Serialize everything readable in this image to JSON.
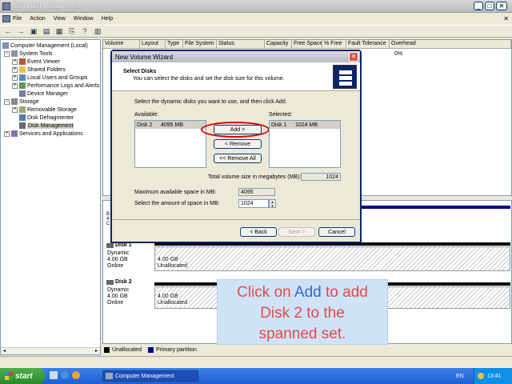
{
  "window": {
    "title": "Computer Management"
  },
  "menu": [
    "File",
    "Action",
    "View",
    "Window",
    "Help"
  ],
  "tree": [
    {
      "label": "Computer Management (Local)",
      "level": 0
    },
    {
      "label": "System Tools",
      "level": 1
    },
    {
      "label": "Event Viewer",
      "level": 2
    },
    {
      "label": "Shared Folders",
      "level": 2
    },
    {
      "label": "Local Users and Groups",
      "level": 2
    },
    {
      "label": "Performance Logs and Alerts",
      "level": 2
    },
    {
      "label": "Device Manager",
      "level": 2
    },
    {
      "label": "Storage",
      "level": 1
    },
    {
      "label": "Removable Storage",
      "level": 2
    },
    {
      "label": "Disk Defragmenter",
      "level": 2
    },
    {
      "label": "Disk Management",
      "level": 2
    },
    {
      "label": "Services and Applications",
      "level": 1
    }
  ],
  "columns": [
    "Volume",
    "Layout",
    "Type",
    "File System",
    "Status",
    "Capacity",
    "Free Space",
    "% Free",
    "Fault Tolerance",
    "Overhead"
  ],
  "overhead_value": "0%",
  "disks": [
    {
      "name": "Disk 1",
      "type": "Dynamic",
      "size": "4.00 GB",
      "status": "Online",
      "part_size": "4.00 GB",
      "part_label": "Unallocated"
    },
    {
      "name": "Disk 2",
      "type": "Dynamic",
      "size": "4.00 GB",
      "status": "Online",
      "part_size": "4.00 GB",
      "part_label": "Unallocated"
    }
  ],
  "legend": {
    "unallocated": "Unallocated",
    "primary": "Primary partition"
  },
  "wizard": {
    "title": "New Volume Wizard",
    "heading": "Select Disks",
    "subheading": "You can select the disks and set the disk size for this volume.",
    "instruction": "Select the dynamic disks you want to use, and then click Add.",
    "available_label": "Available:",
    "selected_label": "Selected:",
    "available_item": {
      "disk": "Disk 2",
      "size": "4095 MB"
    },
    "selected_item": {
      "disk": "Disk 1",
      "size": "1024 MB"
    },
    "add": "Add >",
    "remove": "< Remove",
    "remove_all": "<< Remove All",
    "total_label": "Total volume size in megabytes (MB):",
    "total_value": "1024",
    "max_label": "Maximum available space in MB:",
    "max_value": "4095",
    "amount_label": "Select the amount of space in MB:",
    "amount_value": "1024",
    "back": "< Back",
    "next": "Next >",
    "cancel": "Cancel"
  },
  "callout": {
    "line1_pre": "Click on ",
    "line1_key": "Add",
    "line1_post": " to add",
    "line2": "Disk 2 to the",
    "line3": "spanned set."
  },
  "taskbar": {
    "start": "start",
    "task": "Computer Management",
    "lang": "EN",
    "time": "13:41"
  },
  "colors": {
    "titlebar": "#0a246a",
    "accent": "#3366cc",
    "primary_partition": "#00008b",
    "highlight_ring": "#e00000",
    "callout_bg": "#cfe3f7"
  }
}
